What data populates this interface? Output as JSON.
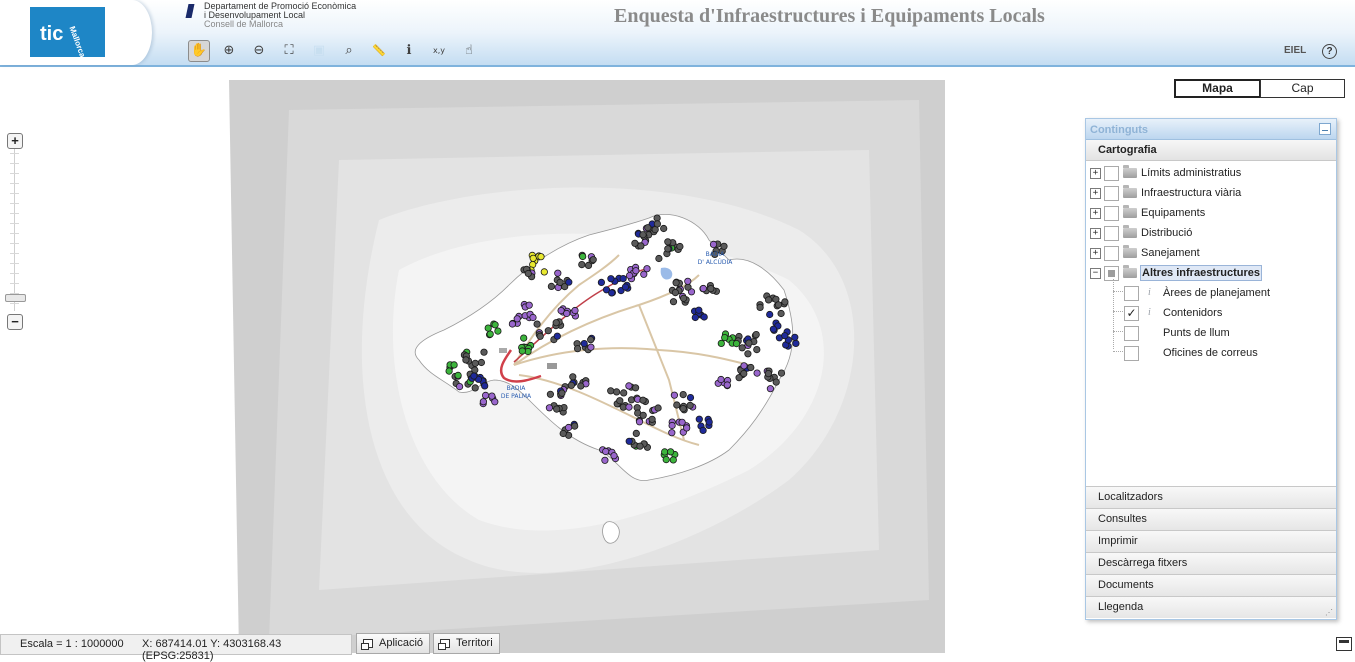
{
  "header": {
    "app_title": "Enquesta d'Infraestructures i Equipaments Locals",
    "logo_text": "tic",
    "logo_subtext": "Mallorca",
    "department_lines": [
      "Departament de Promoció Econòmica",
      "i Desenvolupament Local",
      "Consell de Mallorca"
    ],
    "eiel_label": "EIEL",
    "help_label": "?"
  },
  "toolbar": {
    "tools": [
      {
        "name": "pan-hand-icon",
        "glyph": "✋",
        "active": true
      },
      {
        "name": "zoom-in-icon",
        "glyph": "⊕"
      },
      {
        "name": "zoom-out-icon",
        "glyph": "⊖"
      },
      {
        "name": "zoom-extent-icon",
        "glyph": "⛶"
      },
      {
        "name": "zoom-selection-icon",
        "glyph": "▣",
        "disabled": true
      },
      {
        "name": "zoom-previous-icon",
        "glyph": "⌕"
      },
      {
        "name": "measure-ruler-icon",
        "glyph": "📏"
      },
      {
        "name": "info-icon",
        "glyph": "ℹ"
      },
      {
        "name": "xy-coordinates-icon",
        "glyph": "x,y"
      },
      {
        "name": "select-hand-icon",
        "glyph": "☝"
      }
    ]
  },
  "view_tabs": [
    {
      "label": "Mapa",
      "active": true
    },
    {
      "label": "Cap",
      "active": false
    }
  ],
  "map": {
    "labels": [
      "BADIA",
      "D' ALCÚDIA",
      "BADIA",
      "DE PALMA"
    ],
    "marker_colors": {
      "grey": "#5a5a5a",
      "green": "#3cb43c",
      "purple": "#9966cc",
      "blue": "#1f2a9a",
      "yellow": "#e8e830"
    }
  },
  "panel": {
    "title": "Continguts",
    "section": "Cartografia",
    "layers": [
      {
        "label": "Límits administratius"
      },
      {
        "label": "Infraestructura viària"
      },
      {
        "label": "Equipaments"
      },
      {
        "label": "Distribució"
      },
      {
        "label": "Sanejament"
      },
      {
        "label": "Altres infraestructures"
      }
    ],
    "sublayers": [
      {
        "label": "Àrees de planejament",
        "checked": false,
        "info": "i"
      },
      {
        "label": "Contenidors",
        "checked": true,
        "info": "i"
      },
      {
        "label": "Punts de llum",
        "checked": false
      },
      {
        "label": "Oficines de correus",
        "checked": false
      }
    ],
    "check_mark": "✓",
    "accordion": [
      "Localitzadors",
      "Consultes",
      "Imprimir",
      "Descàrrega fitxers",
      "Documents",
      "Llegenda"
    ]
  },
  "status": {
    "scale": "Escala = 1 : 1000000",
    "coords": "X: 687414.01 Y: 4303168.43",
    "coords_line2": "(EPSG:25831)",
    "buttons": [
      "Aplicació",
      "Territori"
    ]
  },
  "zoom": {
    "plus": "+",
    "minus": "−"
  }
}
